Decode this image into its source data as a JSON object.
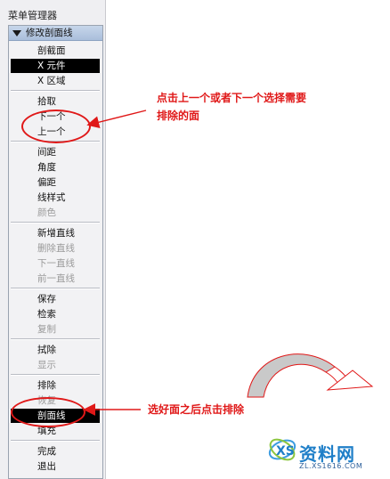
{
  "panel": {
    "title": "菜单管理器"
  },
  "menu": {
    "header": "修改剖面线",
    "groups": [
      [
        {
          "label": "剖截面",
          "state": "normal"
        },
        {
          "label": "X 元件",
          "state": "selected"
        },
        {
          "label": "X 区域",
          "state": "normal"
        }
      ],
      [
        {
          "label": "拾取",
          "state": "normal"
        },
        {
          "label": "下一个",
          "state": "normal"
        },
        {
          "label": "上一个",
          "state": "normal"
        }
      ],
      [
        {
          "label": "间距",
          "state": "normal"
        },
        {
          "label": "角度",
          "state": "normal"
        },
        {
          "label": "偏距",
          "state": "normal"
        },
        {
          "label": "线样式",
          "state": "normal"
        },
        {
          "label": "颜色",
          "state": "disabled"
        }
      ],
      [
        {
          "label": "新增直线",
          "state": "normal"
        },
        {
          "label": "删除直线",
          "state": "disabled"
        },
        {
          "label": "下一直线",
          "state": "disabled"
        },
        {
          "label": "前一直线",
          "state": "disabled"
        }
      ],
      [
        {
          "label": "保存",
          "state": "normal"
        },
        {
          "label": "检索",
          "state": "normal"
        },
        {
          "label": "复制",
          "state": "disabled"
        }
      ],
      [
        {
          "label": "拭除",
          "state": "normal"
        },
        {
          "label": "显示",
          "state": "disabled"
        }
      ],
      [
        {
          "label": "排除",
          "state": "normal"
        },
        {
          "label": "恢复",
          "state": "disabled"
        },
        {
          "label": "剖面线",
          "state": "selected"
        },
        {
          "label": "填充",
          "state": "normal"
        }
      ],
      [
        {
          "label": "完成",
          "state": "normal"
        },
        {
          "label": "退出",
          "state": "normal"
        }
      ]
    ]
  },
  "annotations": {
    "callout_1_line1": "点击上一个或者下一个选择需要",
    "callout_1_line2": "排除的面",
    "callout_2": "选好面之后点击排除"
  },
  "watermark": {
    "text": "资料网",
    "url": "ZL.XS1616.COM"
  },
  "colors": {
    "annotation": "#e01818",
    "selected_bg": "#000000",
    "disabled_text": "#9a9a9a"
  }
}
